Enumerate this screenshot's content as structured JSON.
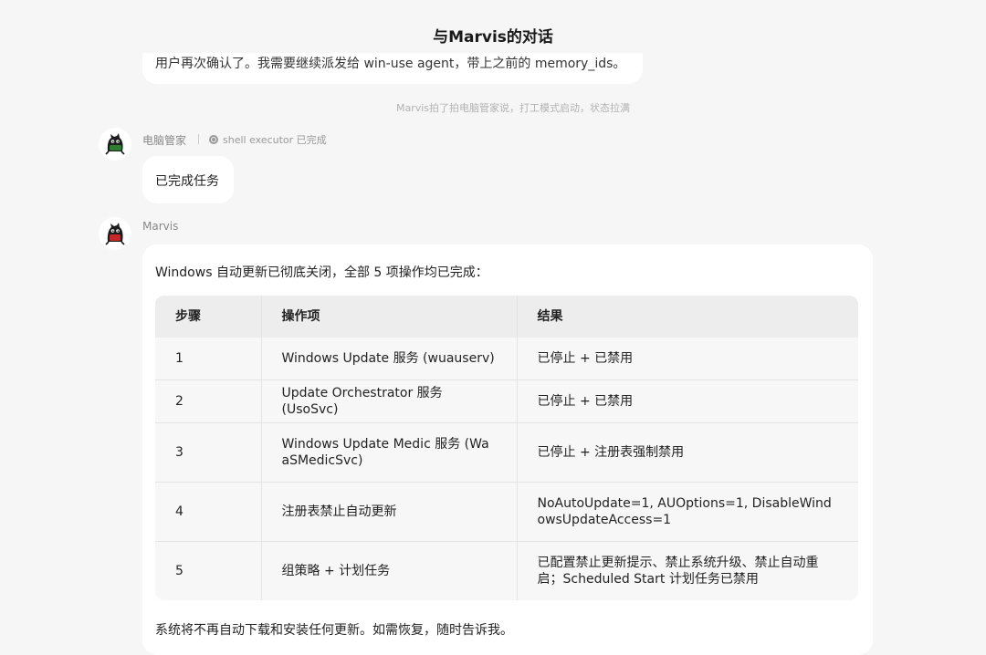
{
  "header": {
    "title": "与Marvis的对话"
  },
  "previous_message": {
    "text": "用户再次确认了。我需要继续派发给 win-use agent，带上之前的 memory_ids。"
  },
  "system_note": "Marvis拍了拍电脑管家说，打工模式启动，状态拉满",
  "pc_manager_message": {
    "sender": "电脑管家",
    "tool_icon": "gear-icon",
    "tool_status": "shell executor 已完成",
    "text": "已完成任务"
  },
  "marvis_message": {
    "sender": "Marvis",
    "intro": "Windows 自动更新已彻底关闭，全部 5 项操作均已完成：",
    "table": {
      "headers": [
        "步骤",
        "操作项",
        "结果"
      ],
      "rows": [
        [
          "1",
          "Windows Update 服务 (wuauserv)",
          "已停止 + 已禁用"
        ],
        [
          "2",
          "Update Orchestrator 服务 (UsoSvc)",
          "已停止 + 已禁用"
        ],
        [
          "3",
          "Windows Update Medic 服务 (WaaSMedicSvc)",
          "已停止 + 注册表强制禁用"
        ],
        [
          "4",
          "注册表禁止自动更新",
          "NoAutoUpdate=1, AUOptions=1, DisableWindowsUpdateAccess=1"
        ],
        [
          "5",
          "组策略 + 计划任务",
          "已配置禁止更新提示、禁止系统升级、禁止自动重启；Scheduled Start 计划任务已禁用"
        ]
      ]
    },
    "outro": "系统将不再自动下载和安装任何更新。如需恢复，随时告诉我。"
  },
  "colors": {
    "background": "#f6f6f6",
    "bubble": "#ffffff",
    "table_header": "#ededed",
    "table_body": "#f7f7f7"
  }
}
